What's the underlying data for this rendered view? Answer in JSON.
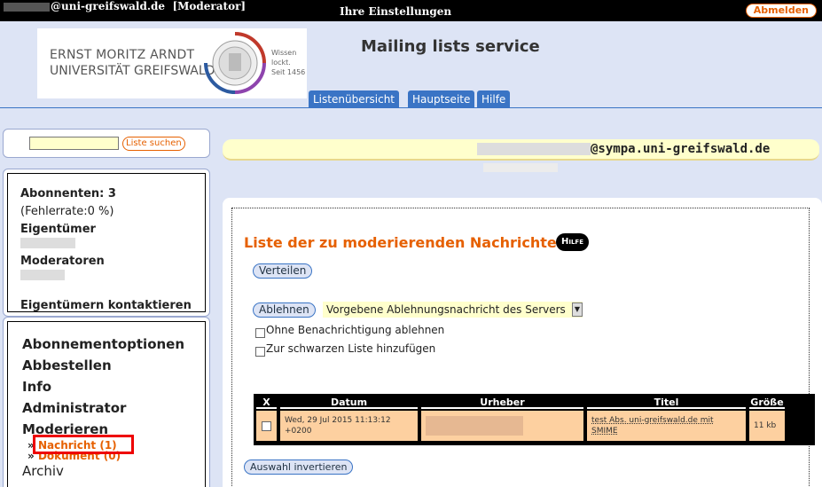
{
  "topbar": {
    "user_suffix": "@uni-greifswald.de",
    "role": "[Moderator]",
    "title": "Ihre Einstellungen",
    "logout": "Abmelden"
  },
  "header": {
    "logo_line1": "ERNST MORITZ ARNDT",
    "logo_line2": "UNIVERSITÄT GREIFSWALD",
    "motto_line1": "Wissen",
    "motto_line2": "lockt.",
    "motto_line3": "Seit 1456",
    "site_title": "Mailing lists service"
  },
  "nav": {
    "tabs": [
      {
        "label": "Listenübersicht"
      },
      {
        "label": "Hauptseite"
      },
      {
        "label": "Hilfe"
      }
    ]
  },
  "search": {
    "value": "",
    "button": "Liste suchen"
  },
  "info": {
    "subscribers": "Abonnenten: 3",
    "error_rate": "(Fehlerrate:0 %)",
    "owners_label": "Eigentümer",
    "moderators_label": "Moderatoren",
    "contact_owners": "Eigentümern kontaktieren"
  },
  "menu": {
    "items": [
      {
        "label": "Abonnementoptionen"
      },
      {
        "label": "Abbestellen"
      },
      {
        "label": "Info"
      },
      {
        "label": "Administrator"
      },
      {
        "label": "Moderieren"
      }
    ],
    "sub_message": "Nachricht (1)",
    "sub_document": "Dokument (0)",
    "archive": "Archiv"
  },
  "list": {
    "domain": "@sympa.uni-greifswald.de"
  },
  "moderation": {
    "heading": "Liste der zu moderierenden Nachrichten",
    "help": "Hilfe",
    "distribute": "Verteilen",
    "reject": "Ablehnen",
    "reject_option": "Vorgebene Ablehnungsnachricht des Servers",
    "reject_silent": "Ohne Benachrichtigung ablehnen",
    "blacklist": "Zur schwarzen Liste hinzufügen",
    "invert": "Auswahl invertieren",
    "columns": [
      "X",
      "Datum",
      "Urheber",
      "Titel",
      "Größe"
    ],
    "rows": [
      {
        "date_line1": "Wed, 29 Jul 2015 11:13:12",
        "date_line2": "+0200",
        "title_line1": "test Abs. uni-greifswald.de mit",
        "title_line2": "SMIME",
        "size": "11 kb"
      }
    ]
  },
  "colors": {
    "accent": "#e66000",
    "nav_blue": "#3a74c5",
    "row_bg": "#fdd0a0",
    "page_bg": "#dde4f5"
  }
}
